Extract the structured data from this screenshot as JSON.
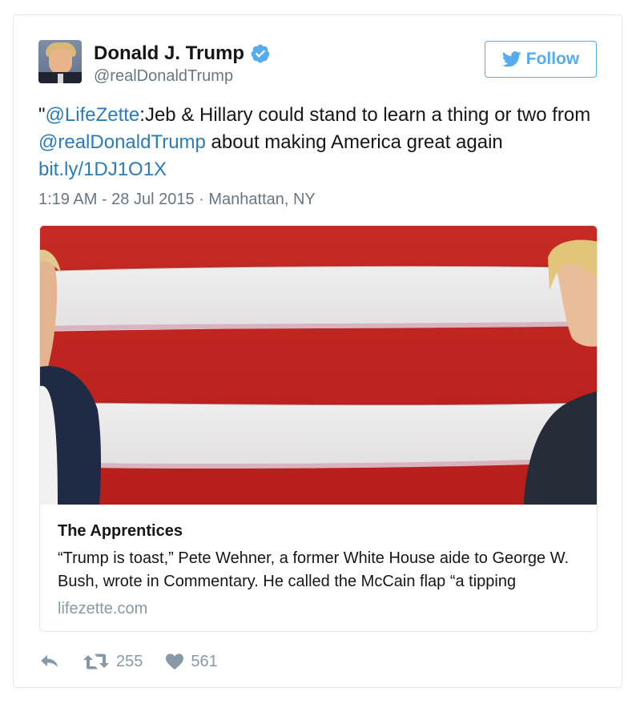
{
  "author": {
    "name": "Donald J. Trump",
    "handle": "@realDonaldTrump",
    "avatar_icon": "profile-photo",
    "verified_icon": "verified-badge-icon"
  },
  "follow_button": {
    "label": "Follow",
    "icon": "twitter-bird-icon"
  },
  "tweet": {
    "prefix_quote": "\"",
    "mention_1": "@LifeZette",
    "text_1": ":Jeb & Hillary could stand to learn a thing or two from ",
    "mention_2": "@realDonaldTrump",
    "text_2": " about making America great again ",
    "link": "bit.ly/1DJ1O1X",
    "timestamp": "1:19 AM - 28 Jul 2015",
    "separator": " · ",
    "location": "Manhattan, NY"
  },
  "card": {
    "title": "The Apprentices",
    "description": "“Trump is toast,” Pete Wehner, a former White House aide to George W. Bush, wrote in Commentary. He called the McCain flap “a tipping",
    "domain": "lifezette.com"
  },
  "actions": {
    "reply_icon": "reply-icon",
    "retweet_icon": "retweet-icon",
    "retweet_count": "255",
    "like_icon": "heart-icon",
    "like_count": "561"
  },
  "colors": {
    "link": "#2b7bb9",
    "twitter_blue": "#55acee",
    "muted": "#657786",
    "border": "#e1e8ed",
    "flag_red": "#c8231f",
    "flag_white": "#eceaea"
  }
}
